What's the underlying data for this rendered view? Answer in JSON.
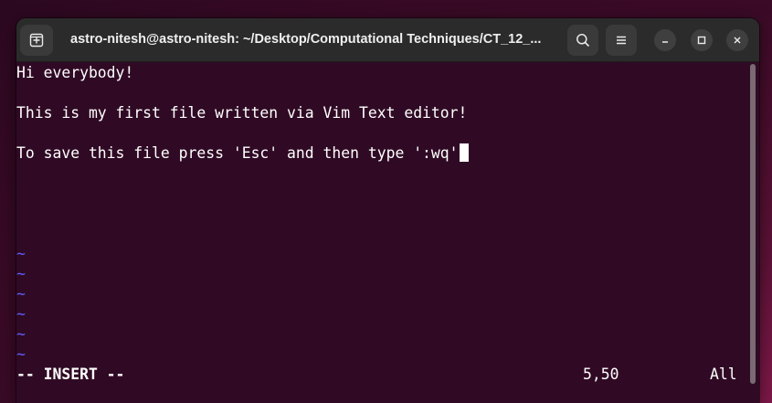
{
  "window": {
    "title": "astro-nitesh@astro-nitesh: ~/Desktop/Computational Techniques/CT_12_..."
  },
  "icons": {
    "new_tab": "new-tab-icon",
    "search": "search-icon",
    "menu": "hamburger-menu-icon",
    "minimize": "minimize-icon",
    "maximize": "maximize-icon",
    "close": "close-icon"
  },
  "editor": {
    "lines": [
      "Hi everybody!",
      "",
      "This is my first file written via Vim Text editor!",
      "",
      "To save this file press 'Esc' and then type ':wq'"
    ],
    "empty_marker": "~",
    "mode": "-- INSERT --",
    "position": "5,50",
    "scroll": "All"
  },
  "colors": {
    "terminal_bg": "#300a24",
    "titlebar_bg": "#2b2b2b",
    "tilde": "#5f5fff",
    "text": "#ffffff"
  }
}
